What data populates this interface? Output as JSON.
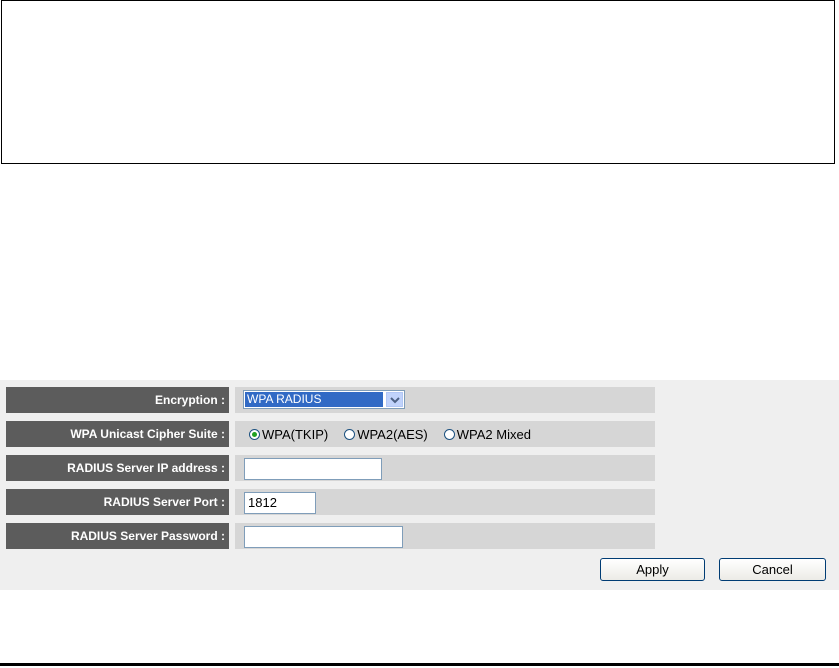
{
  "form": {
    "encryption": {
      "label": "Encryption :",
      "selected": "WPA RADIUS"
    },
    "cipher_suite": {
      "label": "WPA Unicast Cipher Suite :",
      "options": [
        "WPA(TKIP)",
        "WPA2(AES)",
        "WPA2 Mixed"
      ],
      "selected": "WPA(TKIP)"
    },
    "radius_ip": {
      "label": "RADIUS Server IP address :",
      "value": ""
    },
    "radius_port": {
      "label": "RADIUS Server Port :",
      "value": "1812"
    },
    "radius_password": {
      "label": "RADIUS Server Password :",
      "value": ""
    }
  },
  "buttons": {
    "apply_label": "Apply",
    "cancel_label": "Cancel"
  },
  "colors": {
    "label_bg": "#5c5c5c",
    "value_bg": "#d6d6d6",
    "panel_bg": "#efefef",
    "select_highlight": "#316ac5"
  }
}
